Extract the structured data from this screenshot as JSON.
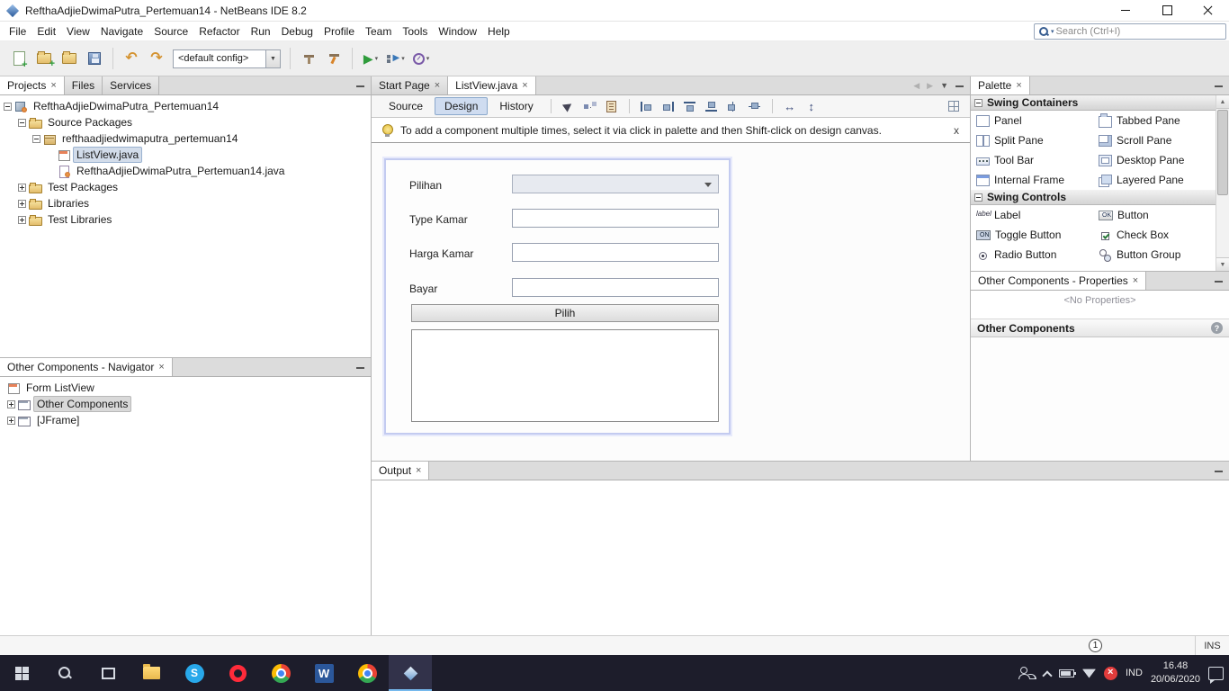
{
  "window": {
    "title": "RefthaAdjieDwimaPutra_Pertemuan14 - NetBeans IDE 8.2"
  },
  "menu_bar": {
    "items": [
      "File",
      "Edit",
      "View",
      "Navigate",
      "Source",
      "Refactor",
      "Run",
      "Debug",
      "Profile",
      "Team",
      "Tools",
      "Window",
      "Help"
    ],
    "search_placeholder": "Search (Ctrl+I)"
  },
  "toolbar": {
    "config_dropdown": "<default config>",
    "icons": [
      "new-file-icon",
      "new-project-icon",
      "open-project-icon",
      "save-all-icon",
      "undo-icon",
      "redo-icon",
      "build-project-icon",
      "clean-build-icon",
      "run-project-icon",
      "debug-project-icon",
      "profile-project-icon"
    ]
  },
  "projects_panel": {
    "tabs": [
      {
        "label": "Projects",
        "active": true,
        "closable": true
      },
      {
        "label": "Files",
        "active": false
      },
      {
        "label": "Services",
        "active": false
      }
    ],
    "tree": [
      {
        "label": "RefthaAdjieDwimaPutra_Pertemuan14",
        "level": 0,
        "expanded": true,
        "icon": "project-icon"
      },
      {
        "label": "Source Packages",
        "level": 1,
        "expanded": true,
        "icon": "folder-icon"
      },
      {
        "label": "refthaadjiedwimaputra_pertemuan14",
        "level": 2,
        "expanded": true,
        "icon": "package-icon"
      },
      {
        "label": "ListView.java",
        "level": 3,
        "selected": true,
        "icon": "form-file-icon"
      },
      {
        "label": "RefthaAdjieDwimaPutra_Pertemuan14.java",
        "level": 3,
        "icon": "java-file-icon"
      },
      {
        "label": "Test Packages",
        "level": 1,
        "expanded": false,
        "icon": "folder-icon"
      },
      {
        "label": "Libraries",
        "level": 1,
        "expanded": false,
        "icon": "folder-icon"
      },
      {
        "label": "Test Libraries",
        "level": 1,
        "expanded": false,
        "icon": "folder-icon"
      }
    ]
  },
  "navigator_panel": {
    "title": "Other Components - Navigator",
    "tree": [
      {
        "label": "Form ListView",
        "icon": "form-icon"
      },
      {
        "label": "Other Components",
        "icon": "window-icon",
        "selected": true,
        "expanded": false
      },
      {
        "label": "[JFrame]",
        "icon": "window-icon",
        "expanded": false
      }
    ]
  },
  "editor": {
    "tabs": [
      {
        "label": "Start Page",
        "active": false
      },
      {
        "label": "ListView.java",
        "active": true
      }
    ],
    "view_buttons": [
      "Source",
      "Design",
      "History"
    ],
    "active_view": "Design",
    "hint": {
      "text": "To add a component multiple times, select it via click in palette and then Shift-click on design canvas."
    },
    "form": {
      "fields": [
        {
          "label": "Pilihan",
          "type": "combobox",
          "value": ""
        },
        {
          "label": "Type Kamar",
          "type": "textfield",
          "value": ""
        },
        {
          "label": "Harga Kamar",
          "type": "textfield",
          "value": ""
        },
        {
          "label": "Bayar",
          "type": "textfield",
          "value": ""
        }
      ],
      "button_label": "Pilih",
      "textarea_value": ""
    }
  },
  "palette": {
    "title": "Palette",
    "sections": [
      {
        "title": "Swing Containers",
        "items": [
          {
            "label": "Panel",
            "icon": "panel-icon"
          },
          {
            "label": "Tabbed Pane",
            "icon": "tabbed-pane-icon"
          },
          {
            "label": "Split Pane",
            "icon": "split-pane-icon"
          },
          {
            "label": "Scroll Pane",
            "icon": "scroll-pane-icon"
          },
          {
            "label": "Tool Bar",
            "icon": "tool-bar-icon"
          },
          {
            "label": "Desktop Pane",
            "icon": "desktop-pane-icon"
          },
          {
            "label": "Internal Frame",
            "icon": "internal-frame-icon"
          },
          {
            "label": "Layered Pane",
            "icon": "layered-pane-icon"
          }
        ]
      },
      {
        "title": "Swing Controls",
        "items": [
          {
            "label": "Label",
            "icon": "label-icon"
          },
          {
            "label": "Button",
            "icon": "button-icon"
          },
          {
            "label": "Toggle Button",
            "icon": "toggle-button-icon"
          },
          {
            "label": "Check Box",
            "icon": "check-box-icon"
          },
          {
            "label": "Radio Button",
            "icon": "radio-button-icon"
          },
          {
            "label": "Button Group",
            "icon": "button-group-icon"
          }
        ]
      }
    ]
  },
  "properties_panel": {
    "title": "Other Components - Properties",
    "empty_text": "<No Properties>"
  },
  "other_components_panel": {
    "title": "Other Components"
  },
  "output_panel": {
    "title": "Output"
  },
  "status_bar": {
    "notification_count": "1",
    "insert_mode": "INS"
  },
  "taskbar": {
    "apps": [
      {
        "icon": "start-icon"
      },
      {
        "icon": "search-icon"
      },
      {
        "icon": "task-view-icon"
      },
      {
        "icon": "file-explorer-icon"
      },
      {
        "icon": "skype-icon"
      },
      {
        "icon": "opera-icon"
      },
      {
        "icon": "chrome-icon"
      },
      {
        "icon": "word-icon"
      },
      {
        "icon": "chrome-icon"
      },
      {
        "icon": "netbeans-icon",
        "active": true
      }
    ],
    "tray_icons": [
      "people-icon",
      "chevron-up-icon",
      "battery-icon",
      "wifi-icon",
      "sync-error-icon",
      "action-center-icon"
    ],
    "language": "IND",
    "time": "16.48",
    "date": "20/06/2020"
  },
  "colors": {
    "active_view_highlight": "#cfdcf0",
    "run_green": "#2f9c3c",
    "undo_orange": "#d4922f",
    "hint_bulb_yellow": "#e3bc35",
    "taskbar_bg": "#1d1d2b",
    "taskbar_active_underline": "#76b9ed",
    "folder_tan": "#e3bd6b"
  }
}
